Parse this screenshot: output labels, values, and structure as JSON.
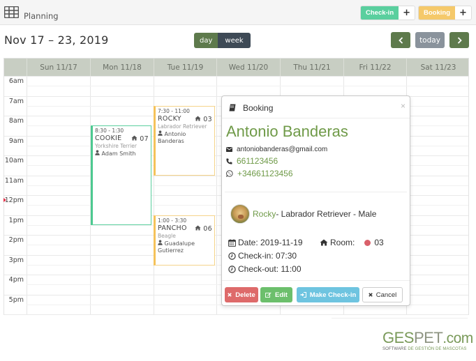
{
  "topbar": {
    "title": "Planning",
    "icon": "table-grid-icon",
    "checkin_label": "Check-in",
    "booking_label": "Booking",
    "plus": "+"
  },
  "toolbar": {
    "range": "Nov 17 – 23, 2019",
    "views": [
      "day",
      "week"
    ],
    "active_view": "week",
    "prev": "‹",
    "today": "today",
    "next": "›"
  },
  "calendar": {
    "days": [
      "Sun 11/17",
      "Mon 11/18",
      "Tue 11/19",
      "Wed 11/20",
      "Thu 11/21",
      "Fri 11/22",
      "Sat 11/23"
    ],
    "hours": [
      "6am",
      "7am",
      "8am",
      "9am",
      "10am",
      "11am",
      "12pm",
      "1pm",
      "2pm",
      "3pm",
      "4pm",
      "5pm"
    ],
    "events": [
      {
        "time": "8:30 - 1:30",
        "pet": "COOKIE",
        "room": "07",
        "breed": "Yorkshire Terrier",
        "owner": "Adam Smith",
        "color": "#4cc990"
      },
      {
        "time": "7:30 - 11:00",
        "pet": "ROCKY",
        "room": "03",
        "breed": "Labrador Retriever",
        "owner": "Antonio Banderas",
        "color": "#f5c25a"
      },
      {
        "time": "1:00 - 3:30",
        "pet": "PANCHO",
        "room": "06",
        "breed": "Beagle",
        "owner": "Guadalupe Gutierrez",
        "color": "#f5c25a"
      }
    ]
  },
  "popup": {
    "title": "Booking",
    "close": "×",
    "client_name": "Antonio Banderas",
    "email": "antoniobanderas@gmail.com",
    "phone": "661123456",
    "whatsapp": "+34661123456",
    "pet_name": "Rocky",
    "pet_details": " - Labrador Retriever - Male",
    "date_label": "Date: 2019-11-19",
    "room_label": "Room:",
    "room_value": "03",
    "room_color": "#d9606a",
    "checkin_label": "Check-in: 07:30",
    "checkout_label": "Check-out: 11:00",
    "buttons": {
      "delete": "Delete",
      "edit": "Edit",
      "make_checkin": "Make Check-in",
      "cancel": "Cancel"
    }
  },
  "logo": {
    "ges": "GES",
    "pet": "PET",
    "com": ".com",
    "tag_a": "SOFTWARE ",
    "tag_b": "DE GESTIÓN DE MASCOTAS"
  }
}
